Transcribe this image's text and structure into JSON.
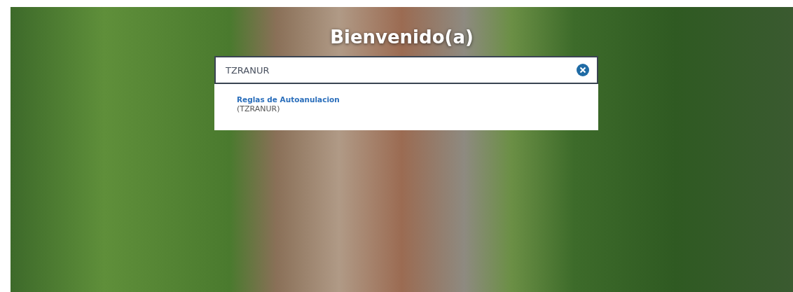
{
  "title": "Bienvenido(a)",
  "search": {
    "value": "TZRANUR"
  },
  "results": [
    {
      "name": "Reglas de Autoanulacion",
      "code": "(TZRANUR)"
    }
  ]
}
